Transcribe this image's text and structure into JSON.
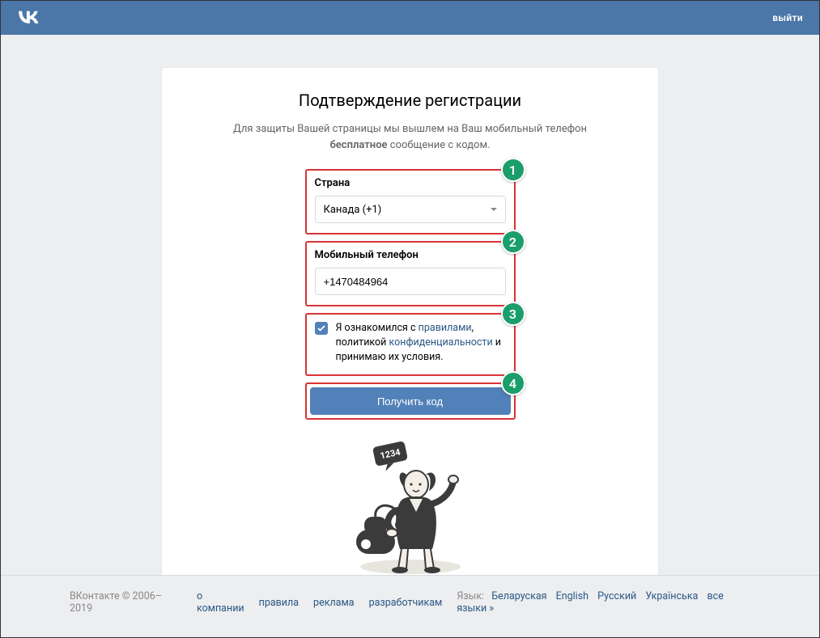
{
  "header": {
    "logout_label": "выйти"
  },
  "page": {
    "title": "Подтверждение регистрации",
    "subtitle_prefix": "Для защиты Вашей страницы мы вышлем на Ваш мобильный телефон ",
    "subtitle_bold": "бесплатное",
    "subtitle_suffix": " сообщение с кодом."
  },
  "form": {
    "country": {
      "label": "Страна",
      "selected": "Канада (+1)"
    },
    "phone": {
      "label": "Мобильный телефон",
      "value": "+1470484964"
    },
    "terms": {
      "checked": true,
      "text_1": "Я ознакомился с ",
      "link_rules": "правилами",
      "text_2": ", политикой ",
      "link_privacy": "конфиденциальности",
      "text_3": " и принимаю их условия."
    },
    "submit_label": "Получить код"
  },
  "markers": {
    "m1": "1",
    "m2": "2",
    "m3": "3",
    "m4": "4"
  },
  "illustration": {
    "code_digits": "1234"
  },
  "footer": {
    "brand": "ВКонтакте",
    "copyright": " © 2006–2019",
    "links": {
      "about": "о компании",
      "rules": "правила",
      "ads": "реклама",
      "devs": "разработчикам"
    },
    "lang_label": "Язык:",
    "langs": {
      "be": "Беларуская",
      "en": "English",
      "ru": "Русский",
      "uk": "Українська",
      "all": "все языки »"
    }
  }
}
